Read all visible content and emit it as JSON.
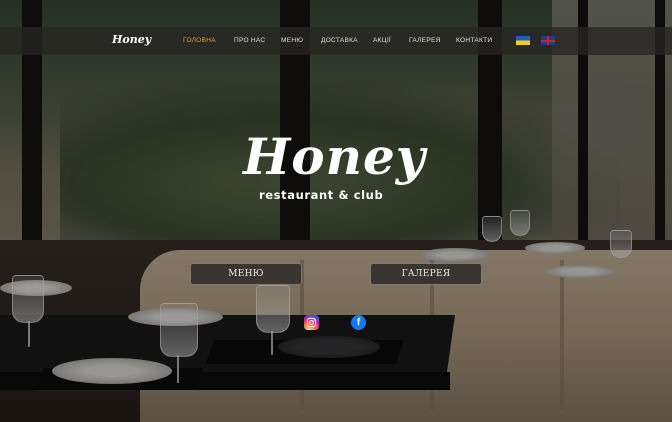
{
  "header": {
    "logo": "Honey",
    "nav": [
      {
        "label": "ГОЛОВНА",
        "active": true
      },
      {
        "label": "ПРО НАС",
        "active": false
      },
      {
        "label": "МЕНЮ",
        "active": false
      },
      {
        "label": "ДОСТАВКА",
        "active": false
      },
      {
        "label": "АКЦІЇ",
        "active": false
      },
      {
        "label": "ГАЛЕРЕЯ",
        "active": false
      },
      {
        "label": "КОНТАКТИ",
        "active": false
      }
    ],
    "languages": [
      {
        "code": "uk",
        "icon": "ukraine-flag-icon"
      },
      {
        "code": "en",
        "icon": "uk-flag-icon"
      }
    ]
  },
  "hero": {
    "title": "Honey",
    "subtitle": "restaurant & club",
    "buttons": {
      "menu": "МЕНЮ",
      "gallery": "ГАЛЕРЕЯ"
    }
  },
  "social": {
    "instagram_icon": "instagram-icon",
    "facebook_icon": "facebook-icon",
    "facebook_glyph": "f"
  },
  "colors": {
    "accent": "#d9a441",
    "nav_text": "#e6e1da"
  }
}
